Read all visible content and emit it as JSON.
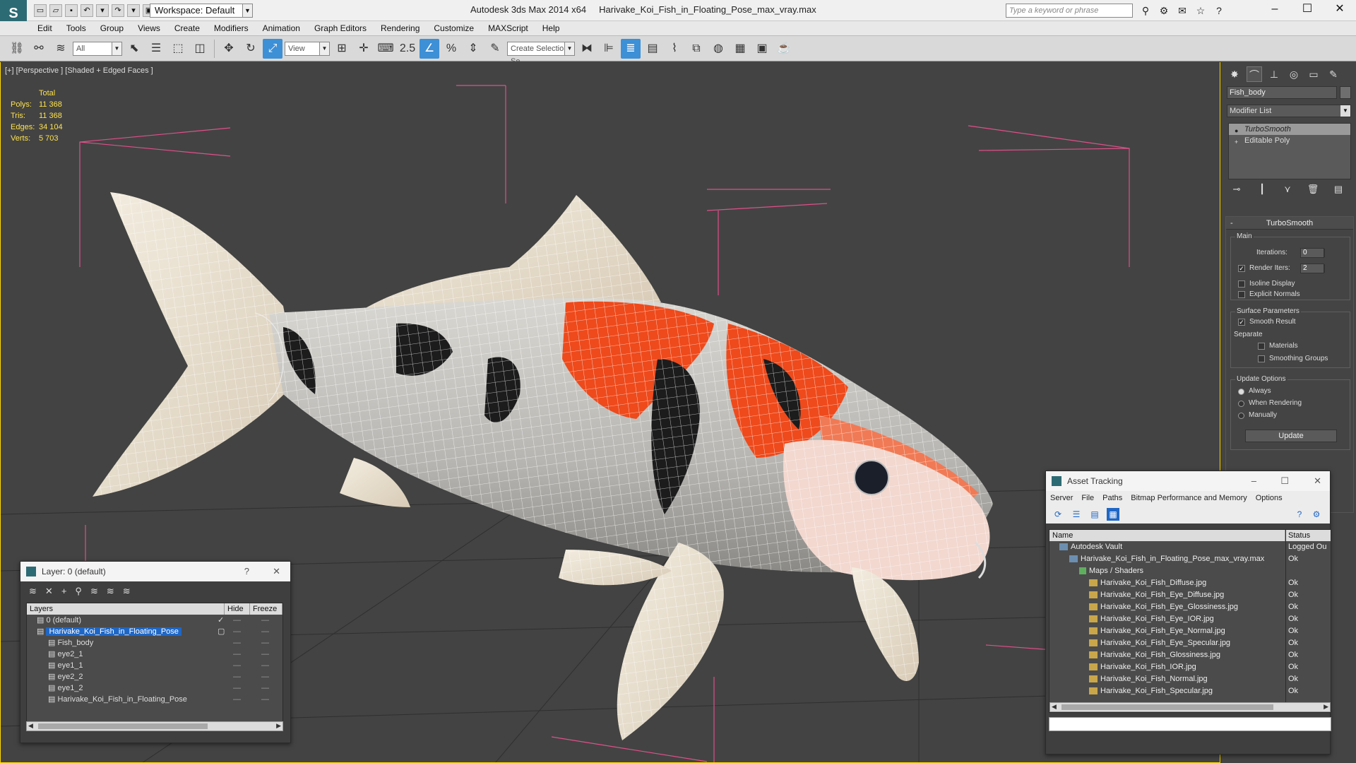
{
  "titlebar": {
    "logo": "S",
    "workspace_label": "Workspace: Default",
    "title_app": "Autodesk 3ds Max  2014 x64",
    "title_file": "Harivake_Koi_Fish_in_Floating_Pose_max_vray.max",
    "search_placeholder": "Type a keyword or phrase"
  },
  "menu": [
    "Edit",
    "Tools",
    "Group",
    "Views",
    "Create",
    "Modifiers",
    "Animation",
    "Graph Editors",
    "Rendering",
    "Customize",
    "MAXScript",
    "Help"
  ],
  "toolbar": {
    "filter_select": "All",
    "view_select": "View",
    "snap_value": "2.5",
    "selection_set": "Create Selection Se"
  },
  "viewport": {
    "label": "[+] [Perspective ] [Shaded + Edged Faces ]",
    "stats_header": "Total",
    "stats": [
      {
        "k": "Polys:",
        "v": "11 368"
      },
      {
        "k": "Tris:",
        "v": "11 368"
      },
      {
        "k": "Edges:",
        "v": "34 104"
      },
      {
        "k": "Verts:",
        "v": "5 703"
      }
    ],
    "colors": {
      "bbox": "#e0508a",
      "body_white": "#f0eee8",
      "body_red": "#ee4a1c",
      "body_black": "#1c1c1c",
      "wire": "#ffffff"
    }
  },
  "command_panel": {
    "object_name": "Fish_body",
    "modifier_list": "Modifier List",
    "stack": [
      "TurboSmooth",
      "Editable Poly"
    ],
    "rollout_title": "TurboSmooth",
    "main_group": "Main",
    "iterations_label": "Iterations:",
    "iterations_value": "0",
    "render_iters_label": "Render Iters:",
    "render_iters_value": "2",
    "isoline": "Isoline Display",
    "explicit_normals": "Explicit Normals",
    "surface_group": "Surface Parameters",
    "smooth_result": "Smooth Result",
    "separate": "Separate",
    "materials": "Materials",
    "smoothing_groups": "Smoothing Groups",
    "update_group": "Update Options",
    "always": "Always",
    "when_rendering": "When Rendering",
    "manually": "Manually",
    "update_button": "Update"
  },
  "layers": {
    "title": "Layer: 0 (default)",
    "help": "?",
    "close": "✕",
    "col_layers": "Layers",
    "col_hide": "Hide",
    "col_freeze": "Freeze",
    "rows": [
      {
        "name": "0 (default)",
        "indent": 14,
        "check": "✓"
      },
      {
        "name": "Harivake_Koi_Fish_in_Floating_Pose",
        "indent": 14,
        "sel": true,
        "check": "▢"
      },
      {
        "name": "Fish_body",
        "indent": 30
      },
      {
        "name": "eye2_1",
        "indent": 30
      },
      {
        "name": "eye1_1",
        "indent": 30
      },
      {
        "name": "eye2_2",
        "indent": 30
      },
      {
        "name": "eye1_2",
        "indent": 30
      },
      {
        "name": "Harivake_Koi_Fish_in_Floating_Pose",
        "indent": 30
      }
    ]
  },
  "asset_tracking": {
    "title": "Asset Tracking",
    "menu": [
      "Server",
      "File",
      "Paths",
      "Bitmap Performance and Memory",
      "Options"
    ],
    "col_name": "Name",
    "col_status": "Status",
    "rows": [
      {
        "name": "Autodesk Vault",
        "status": "Logged Ou",
        "indent": 14,
        "type": "vault"
      },
      {
        "name": "Harivake_Koi_Fish_in_Floating_Pose_max_vray.max",
        "status": "Ok",
        "indent": 28,
        "type": "max"
      },
      {
        "name": "Maps / Shaders",
        "status": "",
        "indent": 42,
        "type": "maps"
      },
      {
        "name": "Harivake_Koi_Fish_Diffuse.jpg",
        "status": "Ok",
        "indent": 56,
        "type": "jpg"
      },
      {
        "name": "Harivake_Koi_Fish_Eye_Diffuse.jpg",
        "status": "Ok",
        "indent": 56,
        "type": "jpg"
      },
      {
        "name": "Harivake_Koi_Fish_Eye_Glossiness.jpg",
        "status": "Ok",
        "indent": 56,
        "type": "jpg"
      },
      {
        "name": "Harivake_Koi_Fish_Eye_IOR.jpg",
        "status": "Ok",
        "indent": 56,
        "type": "jpg"
      },
      {
        "name": "Harivake_Koi_Fish_Eye_Normal.jpg",
        "status": "Ok",
        "indent": 56,
        "type": "jpg"
      },
      {
        "name": "Harivake_Koi_Fish_Eye_Specular.jpg",
        "status": "Ok",
        "indent": 56,
        "type": "jpg"
      },
      {
        "name": "Harivake_Koi_Fish_Glossiness.jpg",
        "status": "Ok",
        "indent": 56,
        "type": "jpg"
      },
      {
        "name": "Harivake_Koi_Fish_IOR.jpg",
        "status": "Ok",
        "indent": 56,
        "type": "jpg"
      },
      {
        "name": "Harivake_Koi_Fish_Normal.jpg",
        "status": "Ok",
        "indent": 56,
        "type": "jpg"
      },
      {
        "name": "Harivake_Koi_Fish_Specular.jpg",
        "status": "Ok",
        "indent": 56,
        "type": "jpg"
      }
    ]
  }
}
